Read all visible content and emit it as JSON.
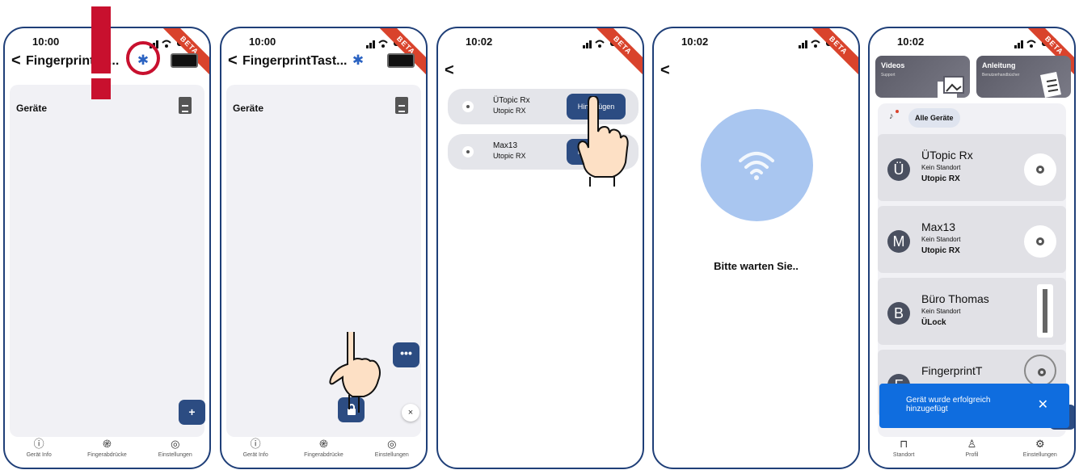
{
  "screens": [
    {
      "time": "10:00",
      "beta": "BETA",
      "title": "FingerprintTa...",
      "section_label": "Geräte",
      "fab_icon": "+",
      "nav": [
        {
          "icon": "info-icon",
          "glyph": "ⓘ",
          "label": "Gerät Info"
        },
        {
          "icon": "fingerprint-icon",
          "glyph": "֎",
          "label": "Fingerabdrücke"
        },
        {
          "icon": "settings-icon",
          "glyph": "◎",
          "label": "Einstellungen"
        }
      ],
      "annotation_exclaim": "!"
    },
    {
      "time": "10:00",
      "beta": "BETA",
      "title": "FingerprintTast...",
      "section_label": "Geräte",
      "fab_more_icon": "•••",
      "fab_lock_icon": "lock-icon",
      "close_icon": "×",
      "nav": [
        {
          "icon": "info-icon",
          "glyph": "ⓘ",
          "label": "Gerät Info"
        },
        {
          "icon": "fingerprint-icon",
          "glyph": "֎",
          "label": "Fingerabdrücke"
        },
        {
          "icon": "settings-icon",
          "glyph": "◎",
          "label": "Einstellungen"
        }
      ]
    },
    {
      "time": "10:02",
      "beta": "BETA",
      "devices": [
        {
          "name": "ÜTopic Rx",
          "model": "Utopic RX",
          "button": "Hinzufügen"
        },
        {
          "name": "Max13",
          "model": "Utopic RX",
          "button": "Hinzufügen"
        }
      ]
    },
    {
      "time": "10:02",
      "beta": "BETA",
      "wait_text": "Bitte warten Sie.."
    },
    {
      "time": "10:02",
      "beta": "BETA",
      "cards": [
        {
          "title": "Videos",
          "subtitle": "Support"
        },
        {
          "title": "Anleitung",
          "subtitle": "Benutzerhandbücher"
        }
      ],
      "filter_chip": "Alle Geräte",
      "locks": [
        {
          "initial": "Ü",
          "name": "ÜTopic Rx",
          "location": "Kein Standort",
          "type": "Utopic RX"
        },
        {
          "initial": "M",
          "name": "Max13",
          "location": "Kein Standort",
          "type": "Utopic RX"
        },
        {
          "initial": "B",
          "name": "Büro Thomas",
          "location": "Kein Standort",
          "type": "ÜLock"
        },
        {
          "initial": "F",
          "name": "FingerprintT",
          "location": "",
          "type": ""
        }
      ],
      "toast": {
        "text": "Gerät wurde erfolgreich hinzugefügt",
        "close": "✕"
      },
      "nav": [
        {
          "icon": "bookmark-icon",
          "glyph": "⊓",
          "label": "Standort"
        },
        {
          "icon": "profile-icon",
          "glyph": "♙",
          "label": "Profil"
        },
        {
          "icon": "gear-icon",
          "glyph": "⚙",
          "label": "Einstellungen"
        }
      ]
    }
  ],
  "colors": {
    "accent": "#2c4c82",
    "border": "#1f3f78",
    "beta": "#d9432c",
    "toast": "#0f6ddf",
    "annotation": "#c8102e"
  }
}
